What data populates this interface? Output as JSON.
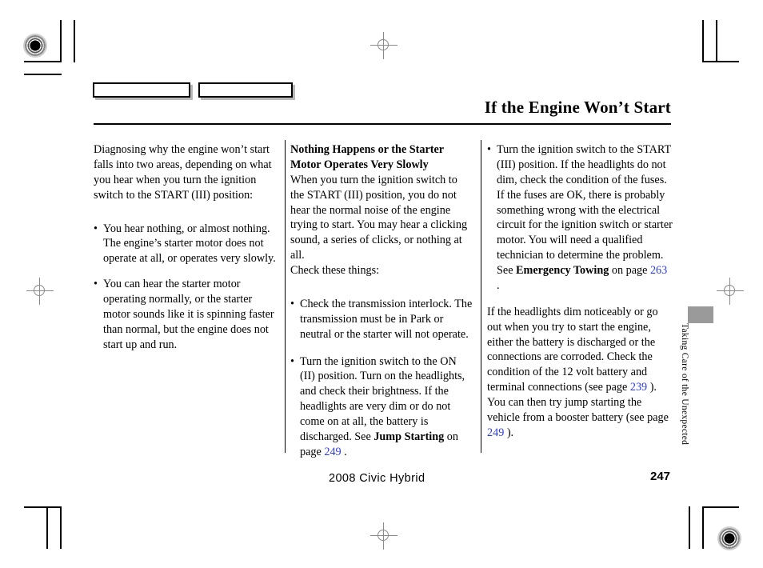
{
  "document": {
    "section_title": "If the Engine Won’t Start",
    "footer_model": "2008  Civic  Hybrid",
    "footer_page_number": "247",
    "side_tab_label": "Taking Care of the Unexpected",
    "link_color": "#2d3de0",
    "tab_marker_color": "#9a9a9a"
  },
  "header": {
    "tab_box_1_label": "",
    "tab_box_2_label": ""
  },
  "columns": {
    "column1": {
      "intro_paragraph": "Diagnosing why the engine won’t start falls into two areas, depending on what you hear when you turn the ignition switch to the START (III) position:",
      "bullets": [
        "You hear nothing, or almost nothing. The engine’s starter motor does not operate at all, or operates very slowly.",
        "You can hear the starter motor operating normally, or the starter motor sounds like it is spinning faster than normal, but the engine does not start up and run."
      ]
    },
    "column2": {
      "subheading_line1": "Nothing Happens or the Starter",
      "subheading_line2": "Motor Operates Very Slowly",
      "body_paragraph": "When you turn the ignition switch to the START (III) position, you do not hear the normal noise of the engine trying to start. You may hear a clicking sound, a series of clicks, or nothing at all.",
      "check_line": "Check these things:",
      "bullet1": "Check the transmission interlock. The transmission must be in Park or neutral or the starter will not operate.",
      "bullet2_text_before_bold": "Turn the ignition switch to the ON (II) position. Turn on the headlights, and check their brightness. If the headlights are very dim or do not come on at all, the battery is discharged. See ",
      "bullet2_bold": "Jump Starting",
      "bullet2_text_mid": " on page ",
      "bullet2_link": "249",
      "bullet2_text_after": " ."
    },
    "column3": {
      "bullet1_text_before_bold": "Turn the ignition switch to the START (III) position. If the headlights do not dim, check the condition of the fuses. If the fuses are OK, there is probably something wrong with the electrical circuit for the ignition switch or starter motor. You will need a qualified technician to determine the problem. See ",
      "bullet1_bold": "Emergency Towing",
      "bullet1_text_mid": " on page ",
      "bullet1_link": "263",
      "bullet1_text_after": " .",
      "paragraph_part1": "If the headlights dim noticeably or go out when you try to start the engine, either the battery is discharged or the connections are corroded. Check the condition of the 12 volt battery and terminal connections (see page ",
      "paragraph_link1": "239",
      "paragraph_part2": " ). You can then try jump starting the vehicle from a booster battery (see page ",
      "paragraph_link2": "249",
      "paragraph_part3": " )."
    }
  },
  "bullet_glyph": "•"
}
